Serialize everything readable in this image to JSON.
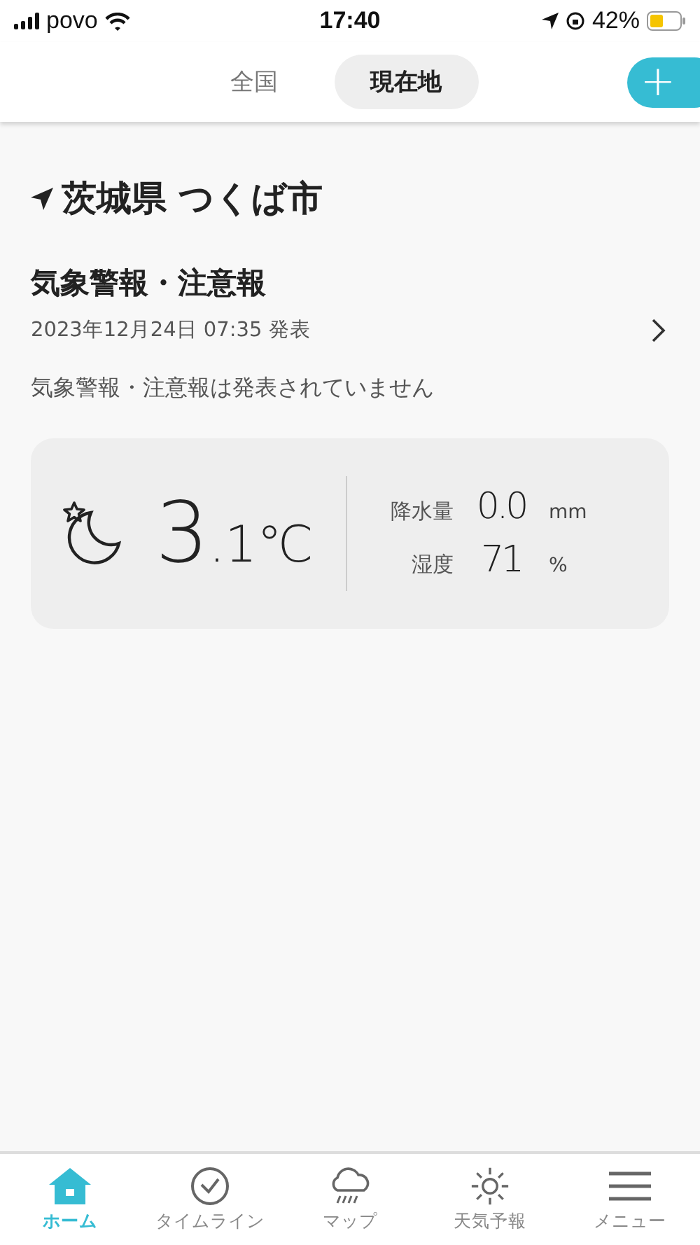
{
  "status_bar": {
    "carrier": "povo",
    "time": "17:40",
    "battery": "42%"
  },
  "tabs": [
    {
      "label": "全国",
      "selected": false
    },
    {
      "label": "現在地",
      "selected": true
    }
  ],
  "add_button": {
    "label": "+"
  },
  "location": {
    "title": "茨城県 つくば市"
  },
  "warnings": {
    "title": "気象警報・注意報",
    "issued": "2023年12月24日 07:35 発表",
    "message": "気象警報・注意報は発表されていません"
  },
  "current": {
    "temp_main": "3",
    "temp_sub": ".1℃",
    "stats": [
      {
        "label": "降水量",
        "value": "0.0",
        "unit": "mm"
      },
      {
        "label": "湿度",
        "value": "71",
        "unit": "%"
      }
    ]
  },
  "nav": [
    {
      "label": "ホーム",
      "kind": "home",
      "selected": true
    },
    {
      "label": "タイムライン",
      "kind": "timeline",
      "selected": false
    },
    {
      "label": "マップ",
      "kind": "map",
      "selected": false
    },
    {
      "label": "天気予報",
      "kind": "forecast",
      "selected": false
    },
    {
      "label": "メニュー",
      "kind": "menu",
      "selected": false
    }
  ]
}
